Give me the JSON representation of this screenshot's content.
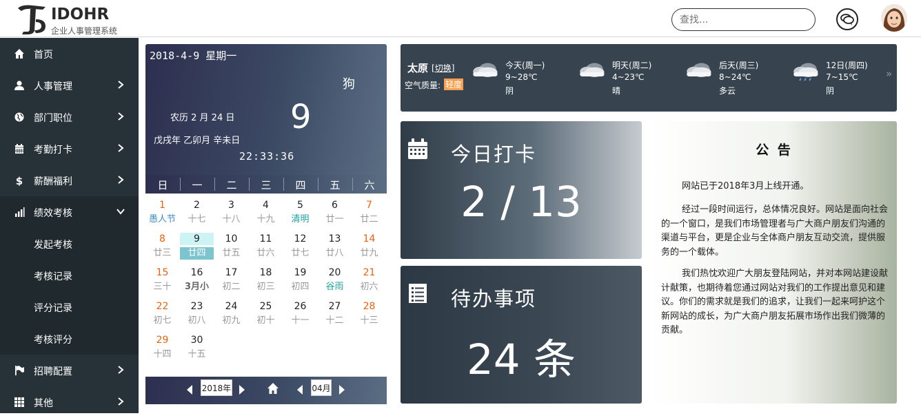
{
  "brand": {
    "title": "IDOHR",
    "subtitle": "企业人事管理系统"
  },
  "header": {
    "search_placeholder": "查找..."
  },
  "sidebar": {
    "items": [
      {
        "label": "首页",
        "icon": "home-icon"
      },
      {
        "label": "人事管理",
        "icon": "user-icon"
      },
      {
        "label": "部门职位",
        "icon": "globe-icon"
      },
      {
        "label": "考勤打卡",
        "icon": "calendar-icon"
      },
      {
        "label": "薪酬福利",
        "icon": "dollar-icon"
      },
      {
        "label": "绩效考核",
        "icon": "bar-chart-icon",
        "expanded": true
      },
      {
        "label": "招聘配置",
        "icon": "flag-icon"
      },
      {
        "label": "其他",
        "icon": "grid-icon"
      }
    ],
    "sub_items": [
      {
        "label": "发起考核"
      },
      {
        "label": "考核记录"
      },
      {
        "label": "评分记录"
      },
      {
        "label": "考核评分"
      }
    ]
  },
  "calendar": {
    "date": "2018-4-9 星期一",
    "zodiac": "狗",
    "lunar": "农历 2 月 24 日",
    "big_day": "9",
    "ganzhi": "戊戌年 乙卯月 辛未日",
    "time": "22:33:36",
    "weekdays": [
      "日",
      "一",
      "二",
      "三",
      "四",
      "五",
      "六"
    ],
    "weeks": [
      [
        {
          "n": "1",
          "l": "愚人节",
          "type": "fest"
        },
        {
          "n": "2",
          "l": "十七"
        },
        {
          "n": "3",
          "l": "十八"
        },
        {
          "n": "4",
          "l": "十九"
        },
        {
          "n": "5",
          "l": "清明",
          "type": "term"
        },
        {
          "n": "6",
          "l": "廿一"
        },
        {
          "n": "7",
          "l": "廿二"
        }
      ],
      [
        {
          "n": "8",
          "l": "廿三"
        },
        {
          "n": "9",
          "l": "廿四",
          "today": true
        },
        {
          "n": "10",
          "l": "廿五"
        },
        {
          "n": "11",
          "l": "廿六"
        },
        {
          "n": "12",
          "l": "廿七"
        },
        {
          "n": "13",
          "l": "廿八"
        },
        {
          "n": "14",
          "l": "廿九"
        }
      ],
      [
        {
          "n": "15",
          "l": "三十"
        },
        {
          "n": "16",
          "l": "3月小",
          "type": "bold"
        },
        {
          "n": "17",
          "l": "初二"
        },
        {
          "n": "18",
          "l": "初三"
        },
        {
          "n": "19",
          "l": "初四"
        },
        {
          "n": "20",
          "l": "谷雨",
          "type": "term"
        },
        {
          "n": "21",
          "l": "初六"
        }
      ],
      [
        {
          "n": "22",
          "l": "初七"
        },
        {
          "n": "23",
          "l": "初八"
        },
        {
          "n": "24",
          "l": "初九"
        },
        {
          "n": "25",
          "l": "初十"
        },
        {
          "n": "26",
          "l": "十一"
        },
        {
          "n": "27",
          "l": "十二"
        },
        {
          "n": "28",
          "l": "十三"
        }
      ],
      [
        {
          "n": "29",
          "l": "十四"
        },
        {
          "n": "30",
          "l": "十五"
        }
      ]
    ],
    "footer": {
      "year": "2018年",
      "month": "04月"
    }
  },
  "weather": {
    "city": "太原",
    "switch_label": "切换",
    "air_label": "空气质量:",
    "air_value": "轻度",
    "days": [
      {
        "label": "今天(周一)",
        "temp": "9~28℃",
        "desc": "阴",
        "icon": "cloud-icon"
      },
      {
        "label": "明天(周二)",
        "temp": "4~23℃",
        "desc": "晴",
        "icon": "cloud-icon"
      },
      {
        "label": "后天(周三)",
        "temp": "8~24℃",
        "desc": "多云",
        "icon": "cloud-icon"
      },
      {
        "label": "12日(周四)",
        "temp": "7~15℃",
        "desc": "阴",
        "icon": "rain-cloud-icon"
      }
    ],
    "more": "»"
  },
  "cards": {
    "checkin": {
      "title": "今日打卡",
      "value": "2 / 13",
      "icon": "calendar-icon"
    },
    "todo": {
      "title": "待办事项",
      "value": "24 条",
      "icon": "list-icon"
    }
  },
  "notice": {
    "title": "公 告",
    "paragraphs": [
      "网站已于2018年3月上线开通。",
      "经过一段时间运行，总体情况良好。网站是面向社会的一个窗口，是我们市场管理者与广大商户朋友们沟通的渠道与平台，更是企业与全体商户朋友互动交流，提供服务的一个载体。",
      "我们热忱欢迎广大朋友登陆网站，并对本网站建设献计献策，也期待着您通过网站对我们的工作提出意见和建议。你们的需求就是我们的追求，让我们一起来呵护这个新网站的成长，为广大商户朋友拓展市场作出我们微薄的贡献。"
    ]
  },
  "colors": {
    "sidebar_bg": "#263238",
    "sidebar_sub_bg": "#1f292e",
    "weekend_red": "#e8620e",
    "festival_blue": "#3a8cc4",
    "solar_term_teal": "#1fa29c",
    "aqi_badge": "#f7a04f"
  }
}
